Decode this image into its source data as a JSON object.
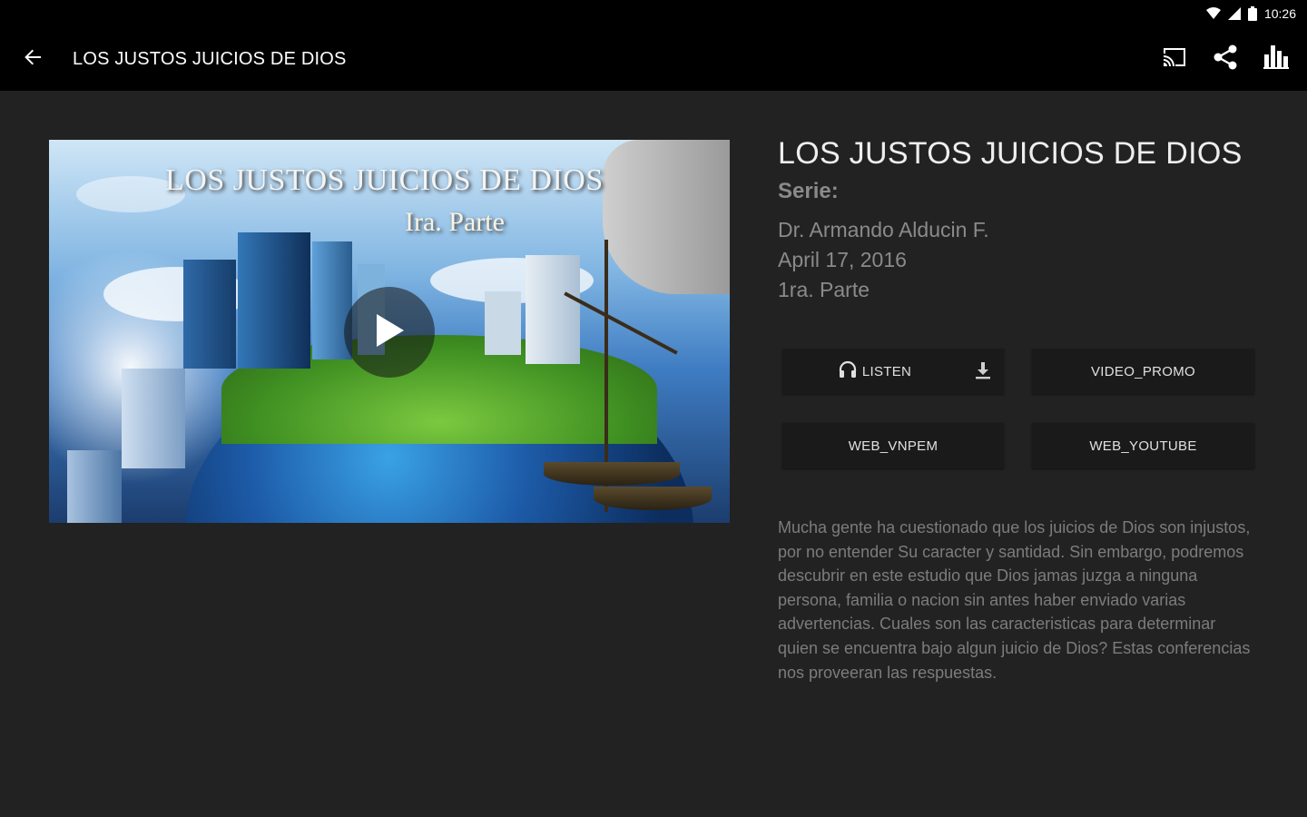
{
  "status_bar": {
    "time": "10:26",
    "icons": [
      "wifi-icon",
      "signal-icon",
      "battery-icon"
    ]
  },
  "app_bar": {
    "back_icon": "arrow-left-icon",
    "title": "LOS JUSTOS JUICIOS DE DIOS",
    "actions": [
      "cast-icon",
      "share-icon",
      "bar-chart-icon"
    ]
  },
  "thumbnail": {
    "caption_line1": "LOS JUSTOS JUICIOS DE DIOS",
    "caption_line2": "Ira. Parte",
    "play_icon": "play-icon"
  },
  "detail": {
    "title": "LOS JUSTOS JUICIOS DE DIOS",
    "series_label": "Serie:",
    "author": "Dr. Armando Alducin F.",
    "date": "April 17, 2016",
    "part": "1ra. Parte"
  },
  "buttons": {
    "listen": "LISTEN",
    "video_promo": "VIDEO_PROMO",
    "web_vnpem": "WEB_VNPEM",
    "web_youtube": "WEB_YOUTUBE"
  },
  "description": "Mucha gente ha cuestionado que los juicios de Dios son injustos, por no entender Su caracter y santidad. Sin embargo, podremos descubrir en este estudio que Dios jamas juzga a ninguna persona, familia o nacion sin antes haber enviado varias advertencias. Cuales son las caracteristicas para determinar quien se encuentra bajo algun juicio de Dios? Estas conferencias nos proveeran las respuestas.",
  "colors": {
    "background": "#222222",
    "app_bar": "#000000",
    "button": "#1a1a1a",
    "secondary_text": "#8a8a8a"
  }
}
